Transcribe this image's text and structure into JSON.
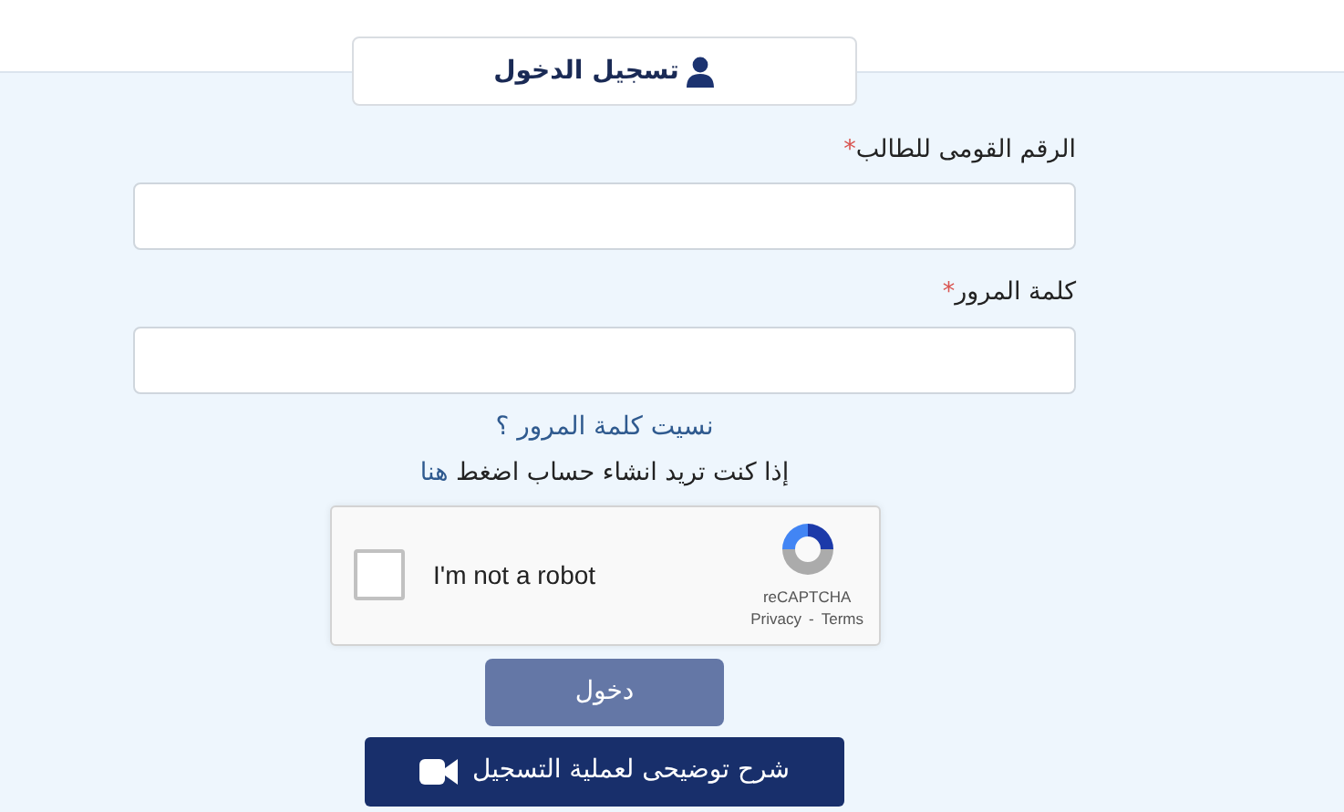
{
  "header": {
    "title": "تسجيل الدخول"
  },
  "fields": [
    {
      "label": "الرقم القومى للطالب",
      "required_mark": "*",
      "required": true
    },
    {
      "label": "كلمة المرور",
      "required_mark": "*",
      "required": true
    }
  ],
  "forgot_link": "نسيت كلمة المرور ؟",
  "signup": {
    "text": "إذا كنت تريد انشاء حساب اضغط",
    "link": "هنا"
  },
  "captcha": {
    "label": "I'm not a robot",
    "checked": false,
    "brand": "reCAPTCHA",
    "privacy": "Privacy",
    "separator": "-",
    "terms": "Terms"
  },
  "login_button": {
    "label": "دخول",
    "disabled": true
  },
  "video_button": {
    "label": "شرح توضيحى لعملية التسجيل"
  }
}
